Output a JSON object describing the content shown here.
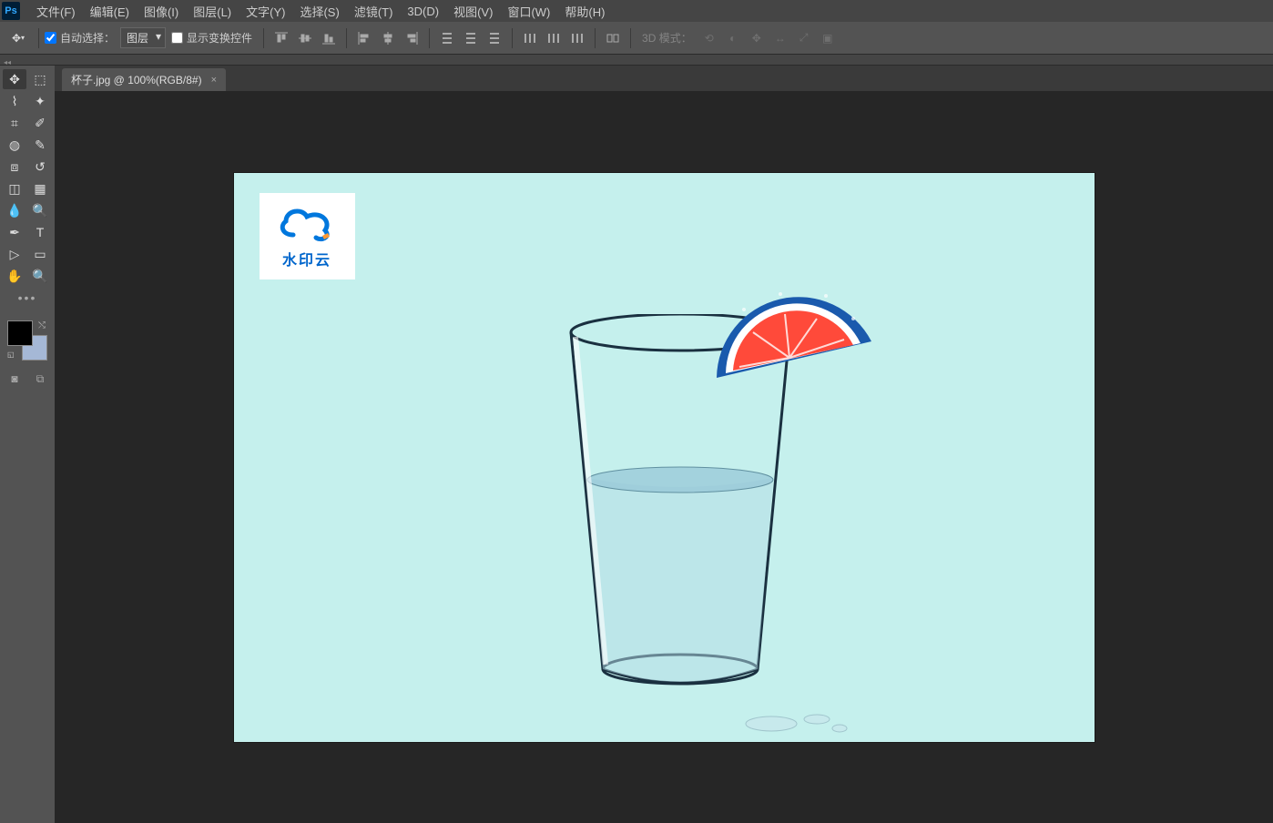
{
  "menu": {
    "items": [
      "文件(F)",
      "编辑(E)",
      "图像(I)",
      "图层(L)",
      "文字(Y)",
      "选择(S)",
      "滤镜(T)",
      "3D(D)",
      "视图(V)",
      "窗口(W)",
      "帮助(H)"
    ]
  },
  "options": {
    "auto_select_label": "自动选择：",
    "auto_select_checked": true,
    "layer_dropdown": "图层",
    "show_transform_label": "显示变换控件",
    "show_transform_checked": false,
    "mode3d_label": "3D 模式："
  },
  "tab": {
    "title": "杯子.jpg @ 100%(RGB/8#)"
  },
  "watermark": {
    "text": "水印云"
  },
  "tools": {
    "rows": [
      [
        "move",
        "marquee"
      ],
      [
        "lasso",
        "magic-wand"
      ],
      [
        "crop",
        "eyedropper"
      ],
      [
        "spot-heal",
        "brush"
      ],
      [
        "clone",
        "history-brush"
      ],
      [
        "eraser",
        "gradient"
      ],
      [
        "blur",
        "dodge"
      ],
      [
        "pen",
        "type"
      ],
      [
        "path-select",
        "shape"
      ],
      [
        "hand",
        "zoom"
      ]
    ],
    "more": "•••"
  },
  "colors": {
    "foreground": "#000000",
    "background": "#a5b8d6"
  }
}
